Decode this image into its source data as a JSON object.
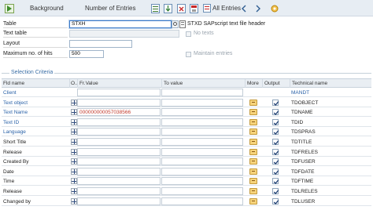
{
  "toolbar": {
    "background_label": "Background",
    "entries_label": "Number of Entries",
    "all_entries_label": "All Entries"
  },
  "form": {
    "table_label": "Table",
    "table_value": "STXH",
    "table_description": "STXD SAPscript text file header",
    "text_table_label": "Text table",
    "no_texts_label": "No texts",
    "layout_label": "Layout",
    "max_hits_label": "Maximum no. of hits",
    "max_hits_value": "500",
    "maintain_entries_label": "Maintain entries"
  },
  "selection": {
    "title": "Selection Criteria",
    "columns": {
      "fld_name": "Fld name",
      "option": "O..",
      "fr_value": "Fr.Value",
      "to_value": "To value",
      "more": "More",
      "output": "Output",
      "technical_name": "Technical name"
    },
    "rows": [
      {
        "fld": "Client",
        "tech": "MANDT",
        "from": "",
        "link": true,
        "op": false,
        "more": false,
        "out": false
      },
      {
        "fld": "Text object",
        "tech": "TDOBJECT",
        "from": "",
        "link": true,
        "op": true,
        "more": true,
        "out": true
      },
      {
        "fld": "Text Name",
        "tech": "TDNAME",
        "from": "000000000057038566",
        "link": true,
        "op": true,
        "more": true,
        "out": true
      },
      {
        "fld": "Text ID",
        "tech": "TDID",
        "from": "",
        "link": true,
        "op": true,
        "more": true,
        "out": true
      },
      {
        "fld": "Language",
        "tech": "TDSPRAS",
        "from": "",
        "link": true,
        "op": true,
        "more": true,
        "out": true
      },
      {
        "fld": "Short Title",
        "tech": "TDTITLE",
        "from": "",
        "link": false,
        "op": true,
        "more": true,
        "out": true
      },
      {
        "fld": "Release",
        "tech": "TDFRELES",
        "from": "",
        "link": false,
        "op": true,
        "more": true,
        "out": true
      },
      {
        "fld": "Created By",
        "tech": "TDFUSER",
        "from": "",
        "link": false,
        "op": true,
        "more": true,
        "out": true
      },
      {
        "fld": "Date",
        "tech": "TDFDATE",
        "from": "",
        "link": false,
        "op": true,
        "more": true,
        "out": true
      },
      {
        "fld": "Time",
        "tech": "TDFTIME",
        "from": "",
        "link": false,
        "op": true,
        "more": true,
        "out": true
      },
      {
        "fld": "Release",
        "tech": "TDLRELES",
        "from": "",
        "link": false,
        "op": true,
        "more": true,
        "out": true
      },
      {
        "fld": "Changed by",
        "tech": "TDLUSER",
        "from": "",
        "link": false,
        "op": true,
        "more": true,
        "out": true
      }
    ]
  },
  "colors": {
    "link": "#2a62a8",
    "from_value": "#c0392b",
    "toolbar_bg": "#e7edf3"
  }
}
